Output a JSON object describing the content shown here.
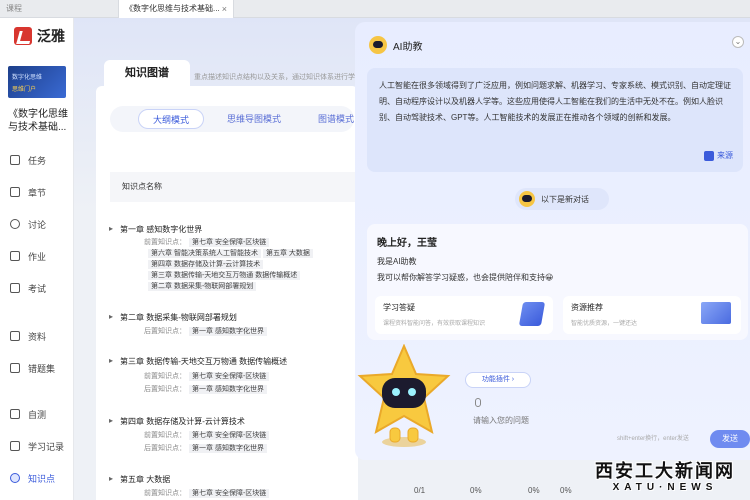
{
  "tabs": [
    {
      "label": "课程"
    },
    {
      "label": "《数字化思维与技术基础...",
      "close": "×"
    }
  ],
  "sidebar": {
    "logo_text": "泛雅",
    "cover_line1": "数字化思维",
    "cover_line2": "思维门户",
    "course_name": "《数字化思维与技术基础...",
    "items": [
      {
        "label": "任务",
        "icon": "task-icon"
      },
      {
        "label": "章节",
        "icon": "chapter-icon"
      },
      {
        "label": "讨论",
        "icon": "discussion-icon"
      },
      {
        "label": "作业",
        "icon": "homework-icon"
      },
      {
        "label": "考试",
        "icon": "exam-icon"
      },
      {
        "label": "资料",
        "icon": "folder-icon"
      },
      {
        "label": "错题集",
        "icon": "error-book-icon"
      },
      {
        "label": "自测",
        "icon": "self-test-icon"
      },
      {
        "label": "学习记录",
        "icon": "record-icon"
      },
      {
        "label": "知识点",
        "icon": "knowledge-icon"
      }
    ]
  },
  "main": {
    "tab_label": "知识图谱",
    "tab_hint": "重点描述知识点结构以及关系，通过知识体系进行学",
    "modes": [
      "大纲模式",
      "思维导图模式",
      "图谱模式"
    ],
    "table_header": "知识点名称",
    "chapters": [
      {
        "title": "第一章 感知数字化世界",
        "pre_label": "前置知识点：",
        "pre_tags": [
          "第七章 安全保障-区块链"
        ],
        "extra_tags": [
          [
            "第六章 智能决策系统人工智能技术",
            "第五章 大数据"
          ],
          [
            "第四章 数据存储及计算-云计算技术"
          ],
          [
            "第三章 数据传输-天地交互万物通 数据传输概述"
          ],
          [
            "第二章 数据采集-物联网部署规划"
          ]
        ]
      },
      {
        "title": "第二章 数据采集-物联网部署规划",
        "post_label": "后置知识点：",
        "post_tags": [
          "第一章 感知数字化世界"
        ]
      },
      {
        "title": "第三章 数据传输-天地交互万物通 数据传输概述",
        "pre_label": "前置知识点：",
        "pre_tags": [
          "第七章 安全保障-区块链"
        ],
        "post_label": "后置知识点：",
        "post_tags": [
          "第一章 感知数字化世界"
        ]
      },
      {
        "title": "第四章 数据存储及计算-云计算技术",
        "pre_label": "前置知识点：",
        "pre_tags": [
          "第七章 安全保障-区块链"
        ],
        "post_label": "后置知识点：",
        "post_tags": [
          "第一章 感知数字化世界"
        ]
      },
      {
        "title": "第五章 大数据",
        "pre_label": "前置知识点：",
        "pre_tags": [
          "第七章 安全保障-区块链"
        ]
      }
    ],
    "bottom_values": [
      "0/1",
      "0%",
      "0%",
      "0%"
    ]
  },
  "ai": {
    "title": "AI助教",
    "close": "⌄",
    "message": "人工智能在很多领域得到了广泛应用，例如问题求解、机器学习、专家系统、模式识别、自动定理证明、自动程序设计以及机器人学等。这些应用使得人工智能在我们的生活中无处不在。例如人脸识别、自动驾驶技术、GPT等。人工智能技术的发展正在推动各个领域的创新和发展。",
    "source_label": "来源",
    "new_topic": "以下是新对话",
    "greeting": "晚上好，王莹",
    "intro1": "我是AI助教",
    "intro2": "我可以帮你解答学习疑惑，也会提供陪伴和支持😀",
    "cards": [
      {
        "title": "学习答疑",
        "sub": "课程资料智能问答，有效获取课程知识"
      },
      {
        "title": "资源推荐",
        "sub": "智能优质资源，一键还达"
      }
    ],
    "plugin_label": "功能插件 ›",
    "input_placeholder": "请输入您的问题",
    "send_hint": "shift+enter换行，enter发送",
    "send_label": "发送"
  },
  "watermark": {
    "line1": "西安工大新闻网",
    "line2": "XATU·NEWS"
  }
}
